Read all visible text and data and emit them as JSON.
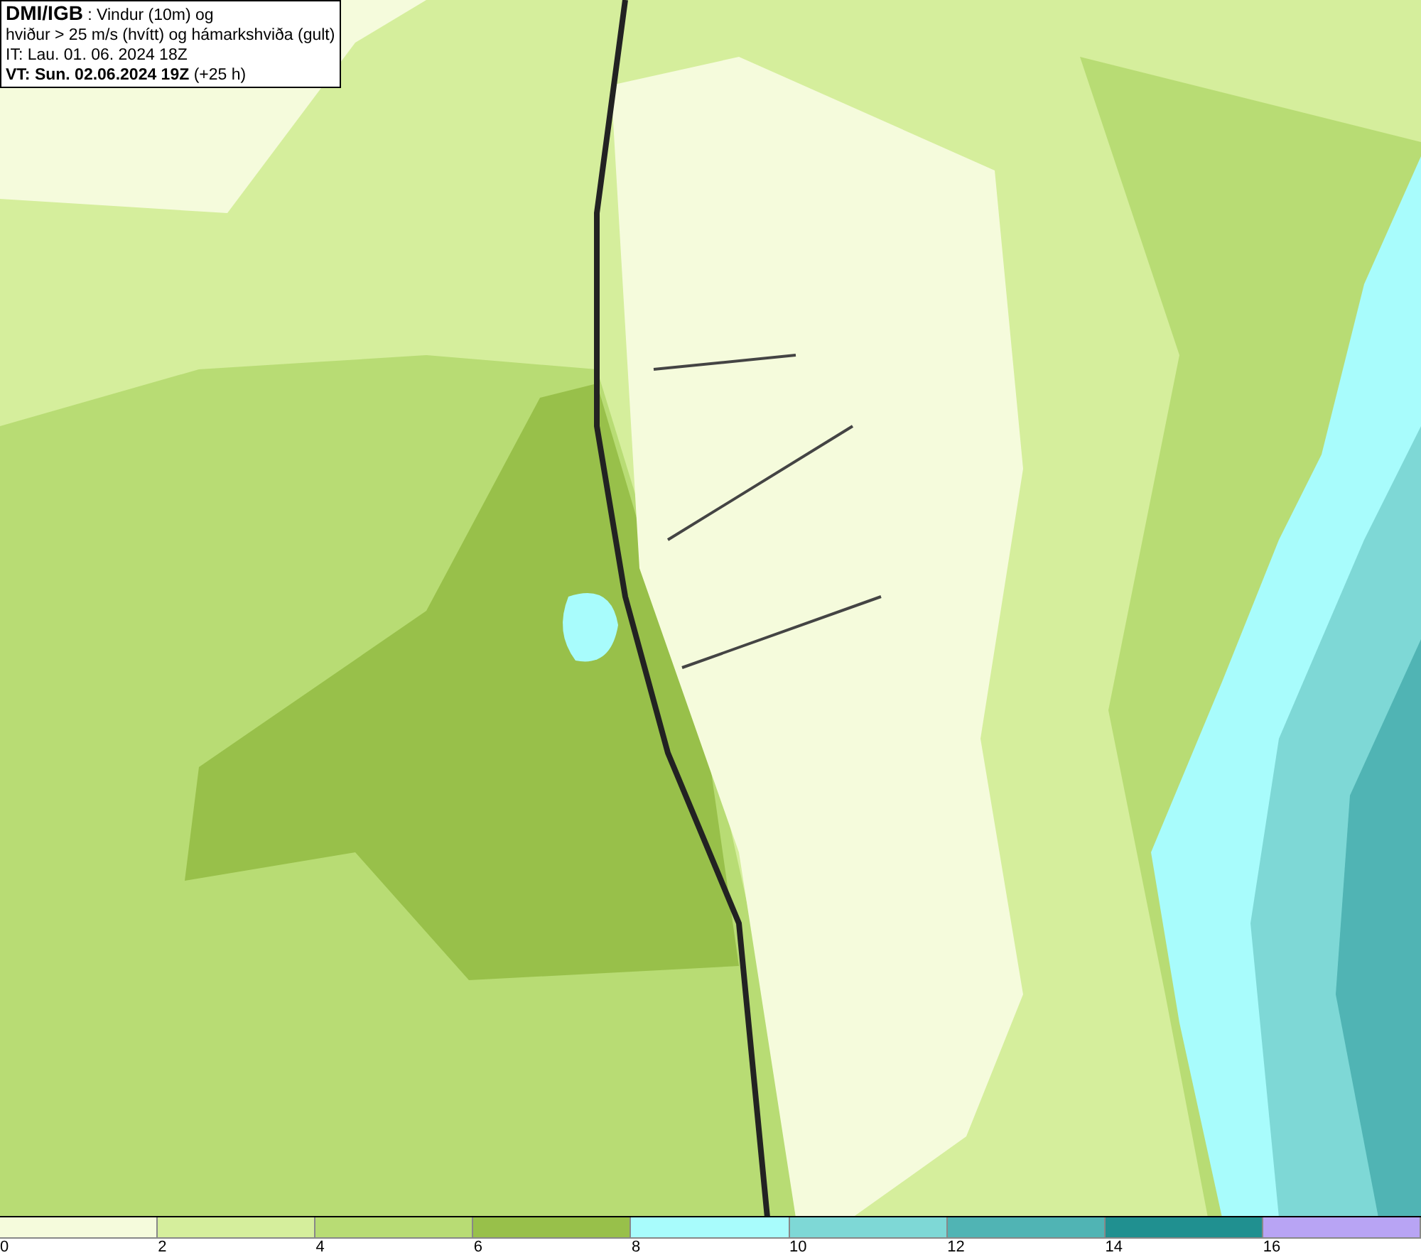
{
  "info_box": {
    "lines": [
      "**DMI/IGB** : Vindur (10m) og",
      "hviður > 25 m/s (hvítt) og hámarkshviða (gult)",
      "IT: Lau. 01. 06. 2024 18Z",
      "**VT: Sun. 02.06.2024 19Z** (+25 h)"
    ]
  },
  "legend": {
    "bins": [
      {
        "color": "#f5fbdc",
        "label": "0"
      },
      {
        "color": "#d5ee9c",
        "label": "2"
      },
      {
        "color": "#b8dc74",
        "label": "4"
      },
      {
        "color": "#98c04a",
        "label": "6"
      },
      {
        "color": "#a8fcfc",
        "label": "8"
      },
      {
        "color": "#7ed8d6",
        "label": "10"
      },
      {
        "color": "#50b4b4",
        "label": "12"
      },
      {
        "color": "#209090",
        "label": "14"
      },
      {
        "color": "#b8a4f4",
        "label": "16"
      }
    ]
  }
}
